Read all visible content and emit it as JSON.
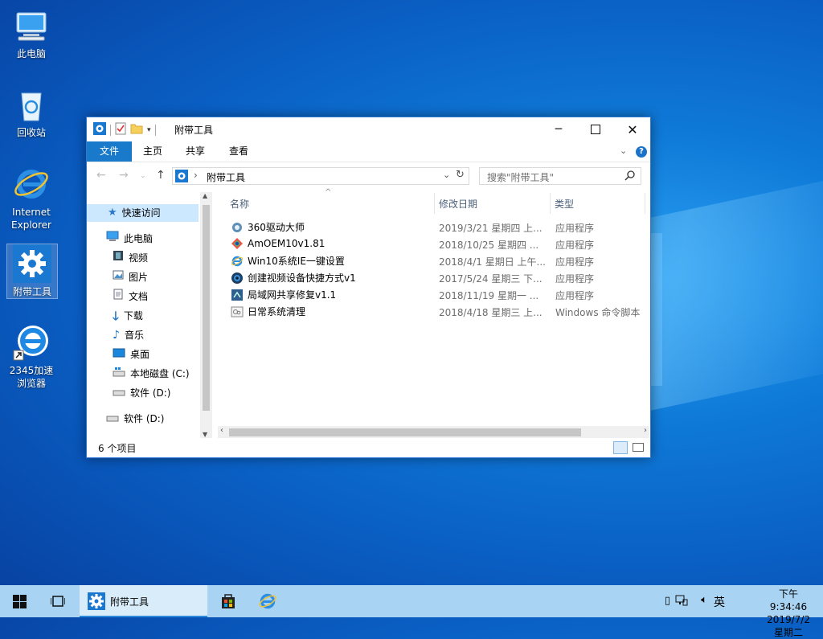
{
  "desktop": {
    "icons": [
      {
        "label": "此电脑",
        "icon": "computer-icon"
      },
      {
        "label": "回收站",
        "icon": "recycle-bin-icon"
      },
      {
        "label": "Internet Explorer",
        "icon": "ie-icon"
      },
      {
        "label": "附带工具",
        "icon": "gear-folder-icon"
      },
      {
        "label": "2345加速浏览器",
        "icon": "browser-shortcut-icon"
      }
    ]
  },
  "window": {
    "title": "附带工具",
    "ribbon_tabs": [
      "文件",
      "主页",
      "共享",
      "查看"
    ],
    "address": "附带工具",
    "search_placeholder": "搜索\"附带工具\"",
    "columns": {
      "name": "名称",
      "date": "修改日期",
      "type": "类型"
    },
    "files": [
      {
        "name": "360驱动大师",
        "date": "2019/3/21 星期四 上...",
        "type": "应用程序",
        "icon": "driver-app-icon"
      },
      {
        "name": "AmOEM10v1.81",
        "date": "2018/10/25 星期四 ...",
        "type": "应用程序",
        "icon": "oem-app-icon"
      },
      {
        "name": "Win10系统IE一键设置",
        "date": "2018/4/1 星期日 上午...",
        "type": "应用程序",
        "icon": "ie-app-icon"
      },
      {
        "name": "创建视频设备快捷方式v1",
        "date": "2017/5/24 星期三 下...",
        "type": "应用程序",
        "icon": "camera-app-icon"
      },
      {
        "name": "局域网共享修复v1.1",
        "date": "2018/11/19 星期一 ...",
        "type": "应用程序",
        "icon": "network-app-icon"
      },
      {
        "name": "日常系统清理",
        "date": "2018/4/18 星期三 上...",
        "type": "Windows 命令脚本",
        "icon": "script-icon"
      }
    ],
    "nav": {
      "quick_access": "快速访问",
      "this_pc": "此电脑",
      "items": [
        "视频",
        "图片",
        "文档",
        "下载",
        "音乐",
        "桌面",
        "本地磁盘 (C:)",
        "软件 (D:)"
      ],
      "drive_d": "软件 (D:)"
    },
    "status": "6 个项目"
  },
  "taskbar": {
    "active_window": "附带工具",
    "ime": "英",
    "time": "下午 9:34:46",
    "date": "2019/7/2 星期二"
  },
  "colors": {
    "accent": "#1979ca",
    "taskbar": "#a9d3f3",
    "selection": "#cce8ff"
  }
}
